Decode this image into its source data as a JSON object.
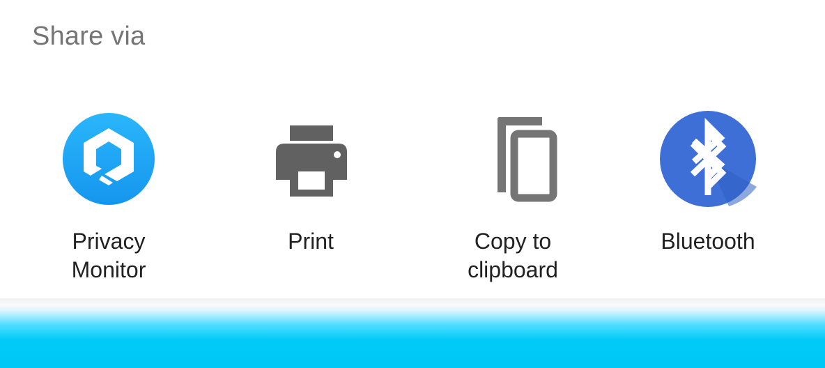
{
  "sheet": {
    "title": "Share via"
  },
  "targets": [
    {
      "label": "Privacy\nMonitor",
      "icon": "privacy-monitor-app-icon",
      "color": "#1aa8f5"
    },
    {
      "label": "Print",
      "icon": "printer-icon",
      "color": "#616161"
    },
    {
      "label": "Copy to\nclipboard",
      "icon": "copy-icon",
      "color": "#757575"
    },
    {
      "label": "Bluetooth",
      "icon": "bluetooth-icon",
      "color": "#3d6fd6"
    }
  ],
  "colors": {
    "bottom_band": "#00c7f5"
  }
}
